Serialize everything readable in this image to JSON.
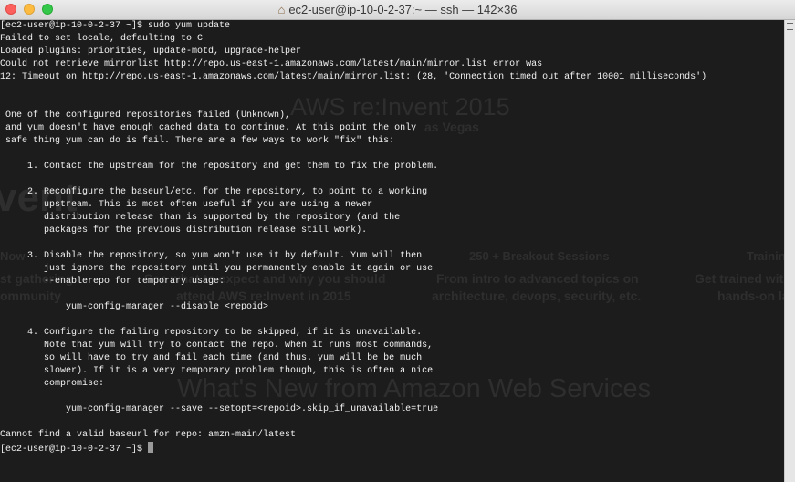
{
  "window": {
    "title": "ec2-user@ip-10-0-2-37:~ — ssh — 142×36",
    "home_icon": "⌂"
  },
  "background_page": {
    "heading": "AWS re:Invent 2015",
    "location": "as Vegas",
    "left_partial": "vent",
    "col1_title": "Now",
    "col1_lines": [
      "st gathering",
      "ommunity"
    ],
    "col2_lines": [
      "See what to expect and why you should",
      "attend AWS re:Invent in 2015"
    ],
    "col3_title": "250 + Breakout Sessions",
    "col3_lines": [
      "From intro to advanced topics on",
      "architecture, devops, security, etc."
    ],
    "col4_title": "Trainin",
    "col4_lines": [
      "Get trained wit",
      "hands-on la"
    ],
    "whats_new": "What's New from Amazon Web Services"
  },
  "terminal": {
    "lines": [
      "[ec2-user@ip-10-0-2-37 ~]$ sudo yum update",
      "Failed to set locale, defaulting to C",
      "Loaded plugins: priorities, update-motd, upgrade-helper",
      "Could not retrieve mirrorlist http://repo.us-east-1.amazonaws.com/latest/main/mirror.list error was",
      "12: Timeout on http://repo.us-east-1.amazonaws.com/latest/main/mirror.list: (28, 'Connection timed out after 10001 milliseconds')",
      "",
      "",
      " One of the configured repositories failed (Unknown),",
      " and yum doesn't have enough cached data to continue. At this point the only",
      " safe thing yum can do is fail. There are a few ways to work \"fix\" this:",
      "",
      "     1. Contact the upstream for the repository and get them to fix the problem.",
      "",
      "     2. Reconfigure the baseurl/etc. for the repository, to point to a working",
      "        upstream. This is most often useful if you are using a newer",
      "        distribution release than is supported by the repository (and the",
      "        packages for the previous distribution release still work).",
      "",
      "     3. Disable the repository, so yum won't use it by default. Yum will then",
      "        just ignore the repository until you permanently enable it again or use",
      "        --enablerepo for temporary usage:",
      "",
      "            yum-config-manager --disable <repoid>",
      "",
      "     4. Configure the failing repository to be skipped, if it is unavailable.",
      "        Note that yum will try to contact the repo. when it runs most commands,",
      "        so will have to try and fail each time (and thus. yum will be be much",
      "        slower). If it is a very temporary problem though, this is often a nice",
      "        compromise:",
      "",
      "            yum-config-manager --save --setopt=<repoid>.skip_if_unavailable=true",
      "",
      "Cannot find a valid baseurl for repo: amzn-main/latest"
    ],
    "prompt": "[ec2-user@ip-10-0-2-37 ~]$"
  }
}
